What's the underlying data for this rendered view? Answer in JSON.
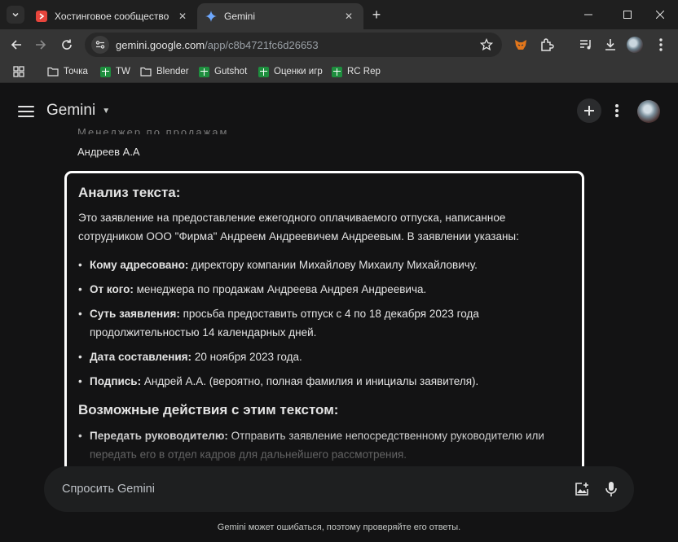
{
  "browser": {
    "tabs": [
      {
        "title": "Хостинговое сообщество «Tim",
        "active": false,
        "favicon": "timeweb-favicon"
      },
      {
        "title": "Gemini",
        "active": true,
        "favicon": "gemini-sparkle-icon"
      }
    ],
    "new_tab_label": "+",
    "address": {
      "host": "gemini.google.com",
      "path": "/app/c8b4721fc6d26653"
    },
    "bookmarks": [
      {
        "label": "Точка",
        "icon": "folder-icon"
      },
      {
        "label": "TW",
        "icon": "sheets-icon"
      },
      {
        "label": "Blender",
        "icon": "folder-icon"
      },
      {
        "label": "Gutshot",
        "icon": "sheets-icon"
      },
      {
        "label": "Оценки игр",
        "icon": "sheets-icon"
      },
      {
        "label": "RC Rep",
        "icon": "sheets-icon"
      }
    ]
  },
  "app": {
    "title": "Gemini",
    "previous_message": {
      "faded_line": "Менеджер по продажам",
      "signature": "Андреев А.А"
    },
    "answer": {
      "heading1": "Анализ текста:",
      "intro": "Это заявление на предоставление ежегодного оплачиваемого отпуска, написанное сотрудником ООО \"Фирма\" Андреем Андреевичем Андреевым. В заявлении указаны:",
      "items": [
        {
          "label": "Кому адресовано:",
          "text": " директору компании Михайлову Михаилу Михайловичу."
        },
        {
          "label": "От кого:",
          "text": " менеджера по продажам Андреева Андрея Андреевича."
        },
        {
          "label": "Суть заявления:",
          "text": " просьба предоставить отпуск с 4 по 18 декабря 2023 года продолжительностью 14 календарных дней."
        },
        {
          "label": "Дата составления:",
          "text": " 20 ноября 2023 года."
        },
        {
          "label": "Подпись:",
          "text": " Андрей А.А. (вероятно, полная фамилия и инициалы заявителя)."
        }
      ],
      "heading2": "Возможные действия с этим текстом:",
      "actions": [
        {
          "label": "Передать руководителю:",
          "text": " Отправить заявление непосредственному руководителю или передать его в отдел кадров для дальнейшего рассмотрения."
        }
      ]
    },
    "input_placeholder": "Спросить Gemini",
    "disclaimer": "Gemini может ошибаться, поэтому проверяйте его ответы."
  }
}
